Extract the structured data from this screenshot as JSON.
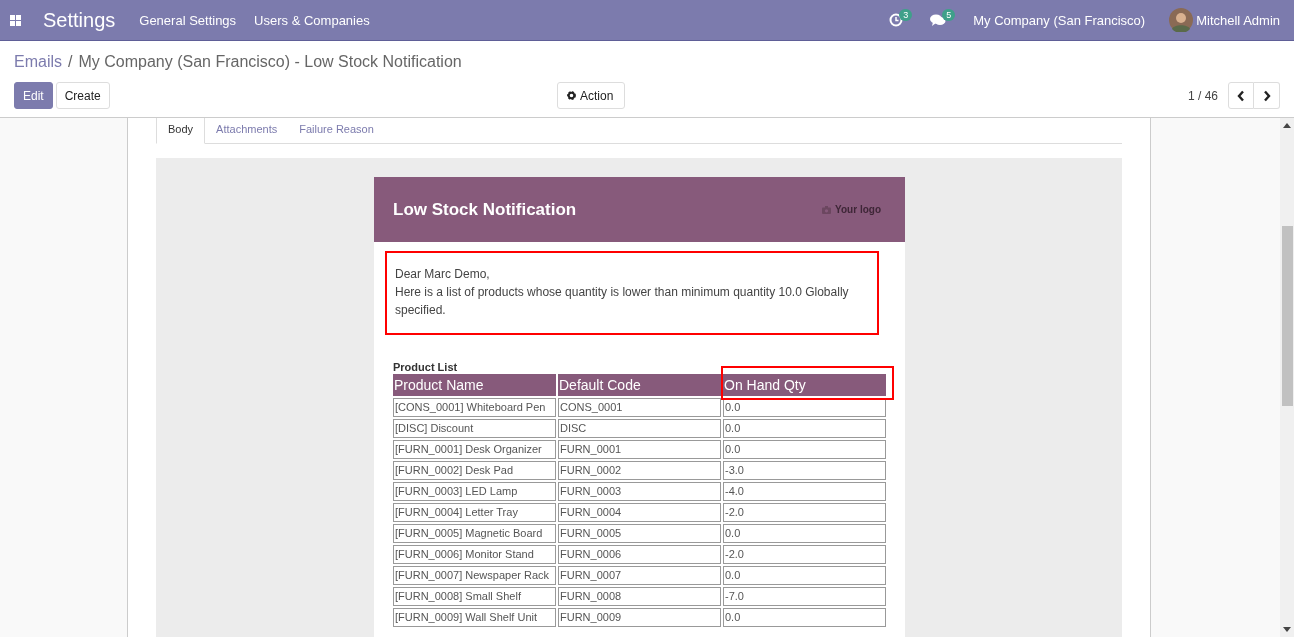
{
  "navbar": {
    "app_title": "Settings",
    "menu": [
      "General Settings",
      "Users & Companies"
    ],
    "activity_count": "3",
    "message_count": "5",
    "company": "My Company (San Francisco)",
    "user": "Mitchell Admin"
  },
  "breadcrumb": {
    "parent": "Emails",
    "separator": "/",
    "current": "My Company (San Francisco) - Low Stock Notification"
  },
  "buttons": {
    "edit": "Edit",
    "create": "Create",
    "action": "Action"
  },
  "pager": {
    "value": "1 / 46"
  },
  "tabs": [
    {
      "label": "Body",
      "selected": true
    },
    {
      "label": "Attachments",
      "selected": false
    },
    {
      "label": "Failure Reason",
      "selected": false
    }
  ],
  "email": {
    "title": "Low Stock Notification",
    "logo": "Your logo",
    "greeting": "Dear Marc Demo,",
    "message": "Here is a list of products whose quantity is lower than minimum quantity 10.0 Globally specified.",
    "message_highlighted": true,
    "list_title": "Product List",
    "columns": [
      {
        "label": "Product Name",
        "highlighted": false
      },
      {
        "label": "Default Code",
        "highlighted": false
      },
      {
        "label": "On Hand Qty",
        "highlighted": true
      }
    ],
    "rows": [
      [
        "[CONS_0001] Whiteboard Pen",
        "CONS_0001",
        "0.0"
      ],
      [
        "[DISC] Discount",
        "DISC",
        "0.0"
      ],
      [
        "[FURN_0001] Desk Organizer",
        "FURN_0001",
        "0.0"
      ],
      [
        "[FURN_0002] Desk Pad",
        "FURN_0002",
        "-3.0"
      ],
      [
        "[FURN_0003] LED Lamp",
        "FURN_0003",
        "-4.0"
      ],
      [
        "[FURN_0004] Letter Tray",
        "FURN_0004",
        "-2.0"
      ],
      [
        "[FURN_0005] Magnetic Board",
        "FURN_0005",
        "0.0"
      ],
      [
        "[FURN_0006] Monitor Stand",
        "FURN_0006",
        "-2.0"
      ],
      [
        "[FURN_0007] Newspaper Rack",
        "FURN_0007",
        "0.0"
      ],
      [
        "[FURN_0008] Small Shelf",
        "FURN_0008",
        "-7.0"
      ],
      [
        "[FURN_0009] Wall Shelf Unit",
        "FURN_0009",
        "0.0"
      ]
    ]
  }
}
